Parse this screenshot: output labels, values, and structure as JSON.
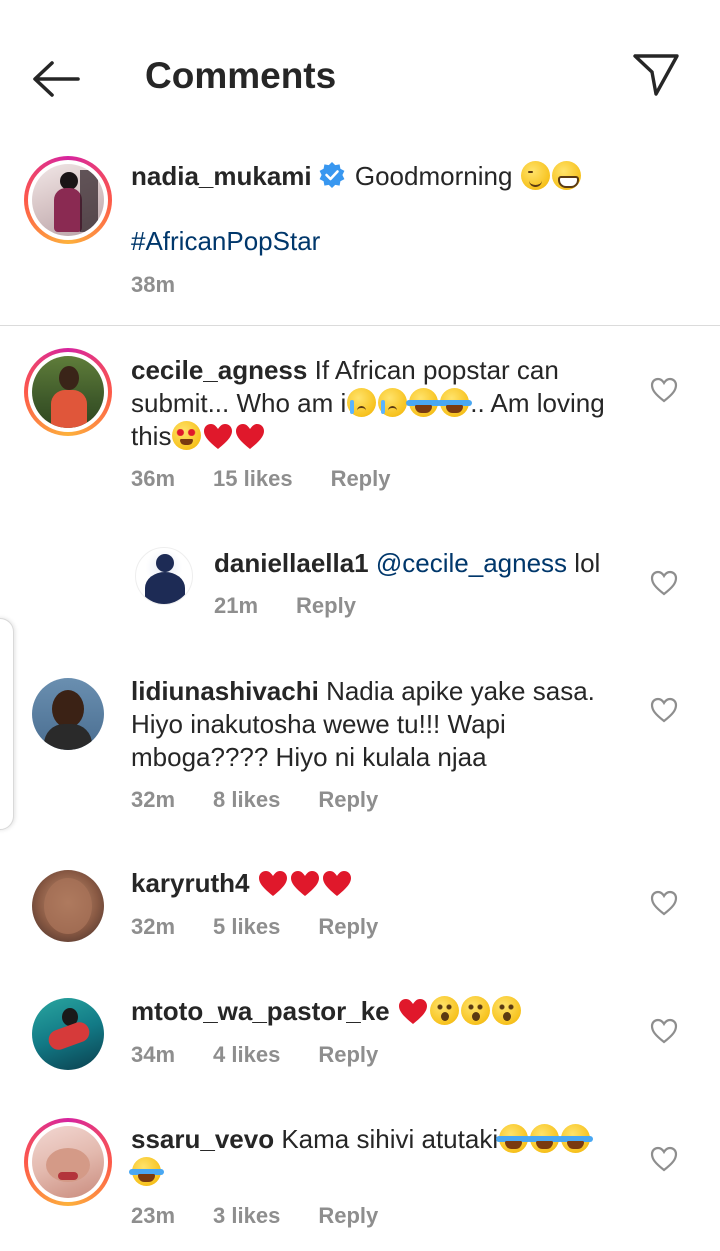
{
  "header": {
    "title": "Comments"
  },
  "caption": {
    "username": "nadia_mukami",
    "text": "Goodmorning",
    "hashtag": "#AfricanPopStar",
    "time": "38m"
  },
  "comments": [
    {
      "username": "cecile_agness",
      "text_1": "If African popstar can submit... Who am i",
      "text_2": ".. Am loving this",
      "time": "36m",
      "likes": "15 likes",
      "reply": "Reply"
    },
    {
      "username": "daniellaella1",
      "mention": "@cecile_agness",
      "text": "lol",
      "time": "21m",
      "reply": "Reply"
    },
    {
      "username": "lidiunashivachi",
      "text": "Nadia apike yake sasa. Hiyo inakutosha wewe tu!!! Wapi mboga???? Hiyo ni kulala njaa",
      "time": "32m",
      "likes": "8 likes",
      "reply": "Reply"
    },
    {
      "username": "karyruth4",
      "time": "32m",
      "likes": "5 likes",
      "reply": "Reply"
    },
    {
      "username": "mtoto_wa_pastor_ke",
      "time": "34m",
      "likes": "4 likes",
      "reply": "Reply"
    },
    {
      "username": "ssaru_vevo",
      "text": "Kama sihivi atutaki",
      "time": "23m",
      "likes": "3 likes",
      "reply": "Reply"
    }
  ],
  "colors": {
    "link": "#00376b",
    "secondary": "#8e8e8e",
    "heart_red": "#e0182b"
  }
}
